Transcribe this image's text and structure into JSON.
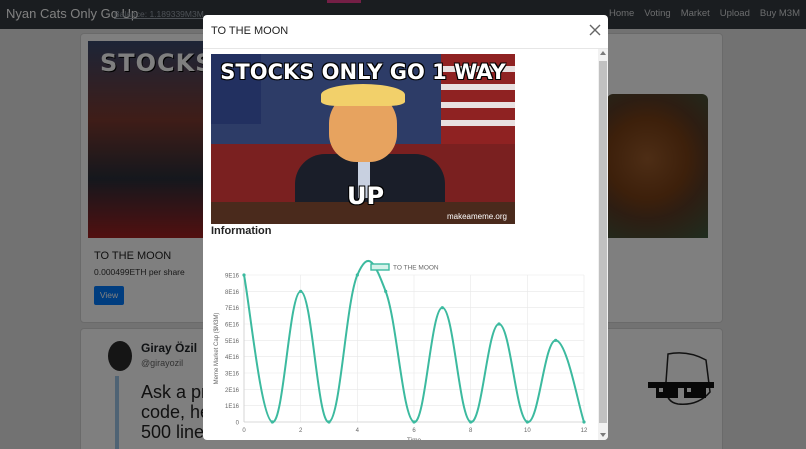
{
  "navbar": {
    "brand": "Nyan Cats Only Go Up",
    "balance": "Balance: 1.189339M3M",
    "links": [
      "Home",
      "Voting",
      "Market",
      "Upload",
      "Buy M3M"
    ]
  },
  "background": {
    "card": {
      "image_caption": "STOCKS",
      "title": "TO THE MOON",
      "price": "0.000499ETH per share",
      "view_label": "View"
    },
    "tweet": {
      "name": "Giray Özil",
      "handle": "@girayozil",
      "text_lines": [
        "Ask a pr",
        "code, he",
        "500 line"
      ]
    }
  },
  "modal": {
    "title": "TO THE MOON",
    "meme": {
      "top_text": "STOCKS ONLY GO 1 WAY",
      "bottom_text": "UP",
      "watermark": "makeameme.org"
    },
    "info_heading": "Information"
  },
  "chart_data": {
    "type": "line",
    "legend": "TO THE MOON",
    "legend_position": "top-center",
    "xlabel": "Time",
    "ylabel": "Meme Market Cap ($M3M)",
    "x": [
      0,
      1,
      2,
      3,
      4,
      5,
      6,
      7,
      8,
      9,
      10,
      11,
      12
    ],
    "y": [
      9e+16,
      0,
      8e+16,
      0,
      9e+16,
      8e+16,
      0,
      7e+16,
      0,
      6e+16,
      0,
      5e+16,
      0
    ],
    "xlim": [
      0,
      12
    ],
    "ylim": [
      0,
      9e+16
    ],
    "x_ticks": [
      "0",
      "2",
      "4",
      "6",
      "8",
      "10",
      "12"
    ],
    "y_ticks": [
      "0",
      "1E16",
      "2E16",
      "3E16",
      "4E16",
      "5E16",
      "6E16",
      "7E16",
      "8E16",
      "9E16"
    ],
    "grid": true,
    "color": "#3cba9f"
  }
}
